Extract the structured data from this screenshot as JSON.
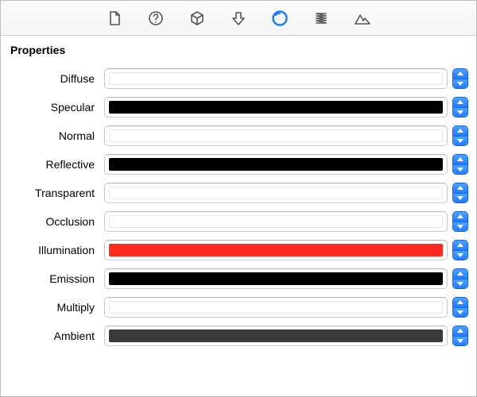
{
  "section_title": "Properties",
  "toolbar": {
    "selected_index": 4,
    "icons": [
      "document-icon",
      "help-icon",
      "cube-icon",
      "down-arrow-icon",
      "sphere-icon",
      "spring-icon",
      "mountains-icon"
    ]
  },
  "colors": {
    "white": "#ffffff",
    "black": "#000000",
    "red": "#ff2a1f",
    "darkgray": "#3a3a3a"
  },
  "properties": [
    {
      "label": "Diffuse",
      "color_key": "white"
    },
    {
      "label": "Specular",
      "color_key": "black"
    },
    {
      "label": "Normal",
      "color_key": "white"
    },
    {
      "label": "Reflective",
      "color_key": "black"
    },
    {
      "label": "Transparent",
      "color_key": "white"
    },
    {
      "label": "Occlusion",
      "color_key": "white"
    },
    {
      "label": "Illumination",
      "color_key": "red"
    },
    {
      "label": "Emission",
      "color_key": "black"
    },
    {
      "label": "Multiply",
      "color_key": "white"
    },
    {
      "label": "Ambient",
      "color_key": "darkgray"
    }
  ]
}
